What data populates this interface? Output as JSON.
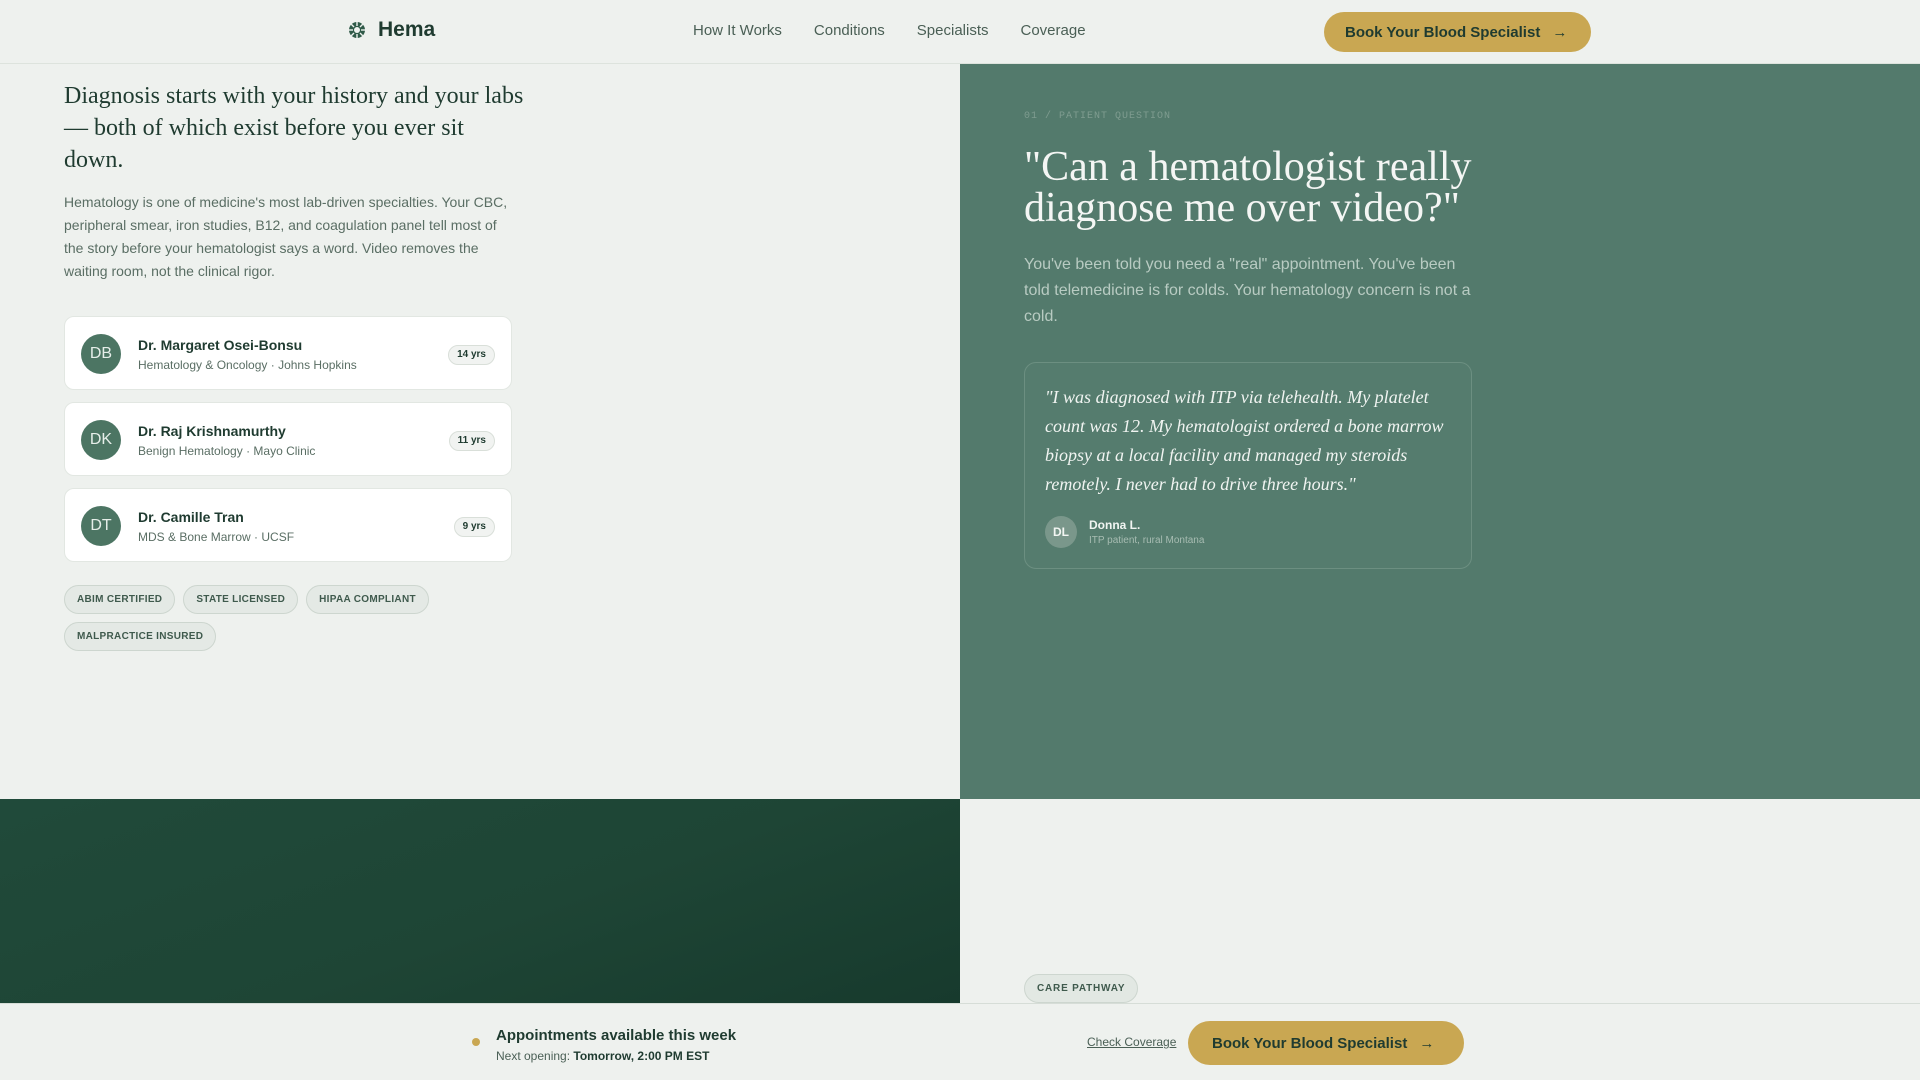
{
  "header": {
    "brand": "Hema",
    "nav": [
      "How It Works",
      "Conditions",
      "Specialists",
      "Coverage"
    ],
    "cta": "Book Your Blood Specialist"
  },
  "left": {
    "headline": "Diagnosis starts with your history and your labs — both of which exist before you ever sit down.",
    "body": "Hematology is one of medicine's most lab-driven specialties. Your CBC, peripheral smear, iron studies, B12, and coagulation panel tell most of the story before your hematologist says a word. Video removes the waiting room, not the clinical rigor.",
    "doctors": [
      {
        "initials": "DB",
        "name": "Dr. Margaret Osei-Bonsu",
        "specialty": "Hematology & Oncology · Johns Hopkins",
        "years": "14 yrs"
      },
      {
        "initials": "DK",
        "name": "Dr. Raj Krishnamurthy",
        "specialty": "Benign Hematology · Mayo Clinic",
        "years": "11 yrs"
      },
      {
        "initials": "DT",
        "name": "Dr. Camille Tran",
        "specialty": "MDS & Bone Marrow · UCSF",
        "years": "9 yrs"
      }
    ],
    "badges": [
      "ABIM CERTIFIED",
      "STATE LICENSED",
      "HIPAA COMPLIANT",
      "MALPRACTICE INSURED"
    ]
  },
  "right": {
    "eyebrow": "01 / PATIENT QUESTION",
    "question": "\"Can a hematologist really diagnose me over video?\"",
    "subtext": "You've been told you need a \"real\" appointment. You've been told telemedicine is for colds. Your hematology concern is not a cold.",
    "quote": {
      "text": "\"I was diagnosed with ITP via telehealth. My platelet count was 12. My hematologist ordered a bone marrow biopsy at a local facility and managed my steroids remotely. I never had to drive three hours.\"",
      "initials": "DL",
      "name": "Donna L.",
      "meta": "ITP patient, rural Montana"
    }
  },
  "lower": {
    "care_badge": "CARE PATHWAY"
  },
  "bottom_bar": {
    "title": "Appointments available this week",
    "next_label": "Next opening:",
    "next_value": "Tomorrow, 2:00 PM EST",
    "check_link": "Check Coverage",
    "cta": "Book Your Blood Specialist"
  },
  "icons": {
    "brand": "blood-cell-icon",
    "cta_arrow": "arrow-right-icon"
  },
  "colors": {
    "accent_gold": "#c9a752",
    "panel_green": "#537a6c",
    "deep_green": "#1e4535",
    "background": "#eef1ee"
  }
}
